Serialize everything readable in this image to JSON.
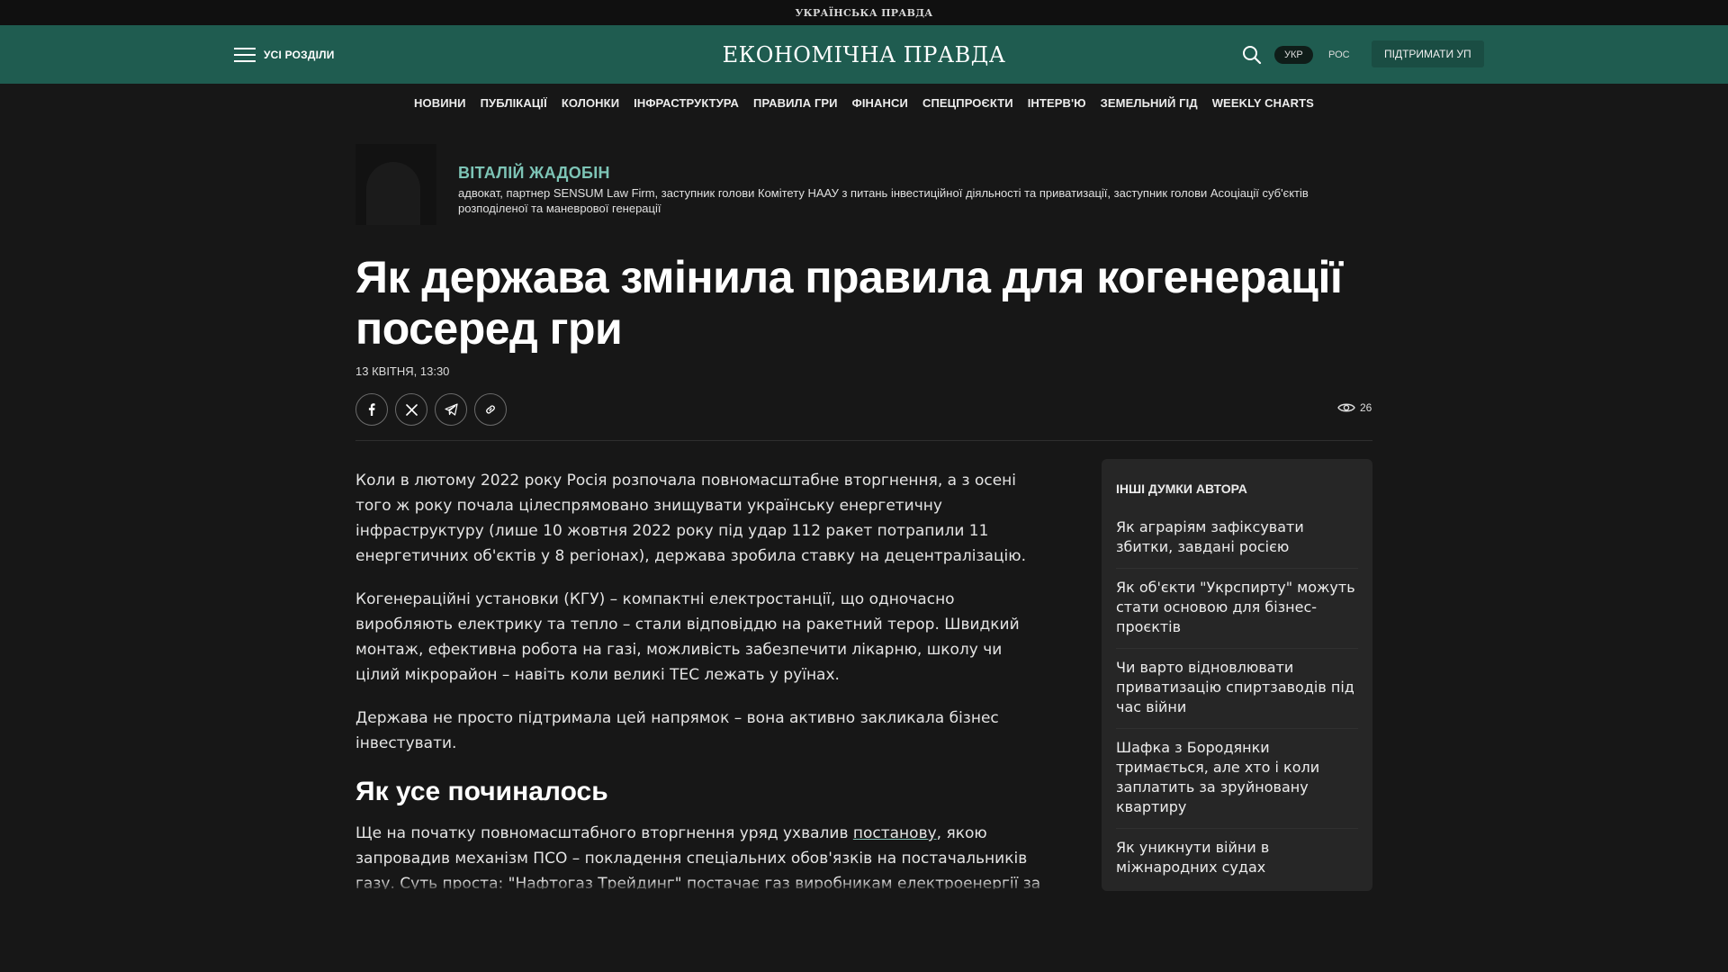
{
  "topbar": {
    "brand": "УКРАЇНСЬКА ПРАВДА"
  },
  "header": {
    "menu_label": "УСІ РОЗДІЛИ",
    "logo": "ЕКОНОМІЧНА ПРАВДА",
    "lang_active": "УКР",
    "lang_other": "РОС",
    "support_label": "ПІДТРИМАТИ УП"
  },
  "nav": {
    "items": [
      "НОВИНИ",
      "ПУБЛІКАЦІЇ",
      "КОЛОНКИ",
      "ІНФРАСТРУКТУРА",
      "ПРАВИЛА ГРИ",
      "ФІНАНСИ",
      "СПЕЦПРОЄКТИ",
      "ІНТЕРВ'Ю",
      "ЗЕМЕЛЬНИЙ ГІД",
      "WEEKLY CHARTS"
    ]
  },
  "author": {
    "name": "ВІТАЛІЙ ЖАДОБІН",
    "description": "адвокат, партнер SENSUM Law Firm, заступник голови Комітету НААУ з питань інвестиційної діяльності та приватизації, заступник голови Асоціації суб'єктів розподіленої та маневрової генерації"
  },
  "article": {
    "title": "Як держава змінила правила для когенерації посеред гри",
    "date": "13 КВІТНЯ, 13:30",
    "views": "26",
    "p1": "Коли в лютому 2022 року Росія розпочала повномасштабне вторгнення, а з осені того ж року почала цілеспрямовано знищувати українську енергетичну інфраструктуру (лише 10 жовтня 2022 року під удар 112 ракет потрапили 11 енергетичних об'єктів у 8 регіонах), держава зробила ставку на децентралізацію.",
    "p2": "Когенераційні установки (КГУ) – компактні електростанції, що одночасно виробляють електрику та тепло – стали відповіддю на ракетний терор. Швидкий монтаж, ефективна робота на газі, можливість забезпечити лікарню, школу чи цілий мікрорайон – навіть коли великі ТЕС лежать у руїнах.",
    "p3": "Держава не просто підтримала цей напрямок – вона активно закликала бізнес інвестувати.",
    "h2": "Як усе починалось",
    "p4_before": "Ще на початку повномасштабного вторгнення уряд ухвалив ",
    "p4_link": "постанову",
    "p4_after": ", якою запровадив механізм ПСО – покладення спеціальних обов'язків на постачальників газу. Суть проста: \"Нафтогаз Трейдинг\" постачає газ виробникам електроенергії за"
  },
  "sidebar": {
    "title": "ІНШІ ДУМКИ АВТОРА",
    "items": [
      "Як аграріям зафіксувати збитки, завдані росією",
      "Як об'єкти \"Укрспирту\" можуть стати основою для бізнес-проєктів",
      "Чи варто відновлювати приватизацію спиртзаводів під час війни",
      "Шафка з Бородянки тримається, але хто і коли заплатить за зруйновану квартиру",
      "Як уникнути війни в міжнародних судах"
    ]
  },
  "colors": {
    "header_bg": "#1f5c50",
    "accent": "#7dc4b6",
    "page_bg": "#171717"
  },
  "icons": {
    "menu": "hamburger-icon",
    "search": "search-icon",
    "share": [
      "facebook-icon",
      "x-icon",
      "telegram-icon",
      "copy-link-icon"
    ],
    "views": "eye-icon"
  }
}
